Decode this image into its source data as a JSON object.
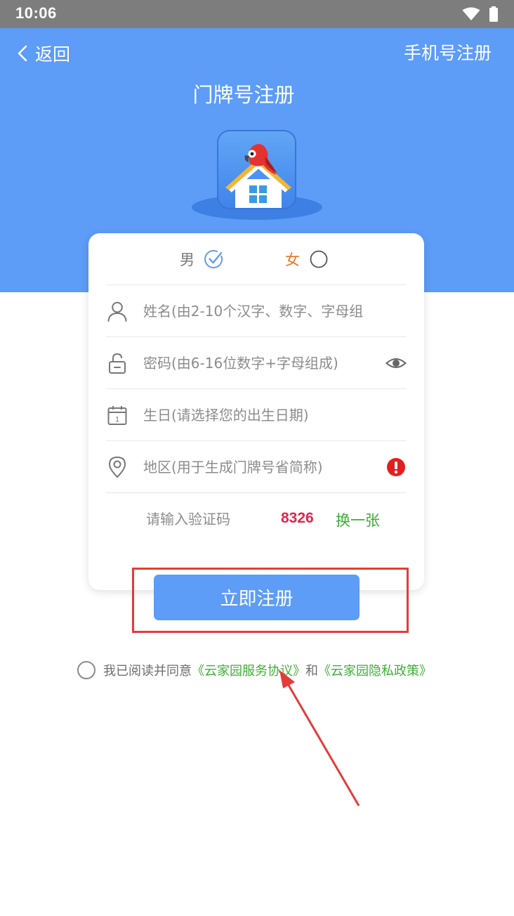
{
  "status_bar": {
    "time": "10:06"
  },
  "header": {
    "back_label": "返回",
    "phone_register_label": "手机号注册",
    "title": "门牌号注册"
  },
  "form": {
    "gender": {
      "male_label": "男",
      "female_label": "女",
      "selected": "男"
    },
    "name_placeholder": "姓名(由2-10个汉字、数字、字母组",
    "password_placeholder": "密码(由6-16位数字+字母组成)",
    "birthday_placeholder": "生日(请选择您的出生日期)",
    "region_placeholder": "地区(用于生成门牌号省简称)",
    "captcha_placeholder": "请输入验证码",
    "captcha_code": "8326",
    "captcha_refresh_label": "换一张"
  },
  "register_button_label": "立即注册",
  "agreement": {
    "prefix": "我已阅读并同意",
    "service_link": "《云家园服务协议》",
    "conjunction": "和",
    "privacy_link": "《云家园隐私政策》"
  },
  "colors": {
    "primary_blue": "#5d9cf7",
    "link_green": "#3dae35",
    "captcha_red": "#e8244e",
    "annotation_red": "#e63a3a",
    "female_orange": "#e8762c"
  }
}
